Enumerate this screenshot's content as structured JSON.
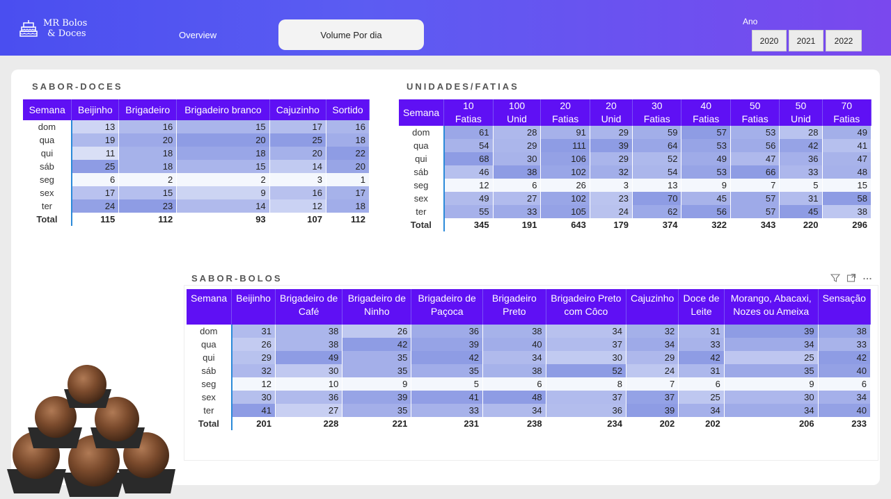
{
  "header": {
    "logo_line1": "MR Bolos",
    "logo_line2": "& Doces",
    "nav_overview": "Overview",
    "nav_volume": "Volume Por dia",
    "ano_label": "Ano",
    "years": [
      "2020",
      "2021",
      "2022"
    ]
  },
  "doces": {
    "title": "SABOR-DOCES",
    "columns": [
      "Semana",
      "Beijinho",
      "Brigadeiro",
      "Brigadeiro branco",
      "Cajuzinho",
      "Sortido"
    ],
    "rows": [
      [
        "dom",
        "13",
        "16",
        "15",
        "17",
        "16"
      ],
      [
        "qua",
        "19",
        "20",
        "20",
        "25",
        "18"
      ],
      [
        "qui",
        "11",
        "18",
        "18",
        "20",
        "22"
      ],
      [
        "sáb",
        "25",
        "18",
        "15",
        "14",
        "20"
      ],
      [
        "seg",
        "6",
        "2",
        "2",
        "3",
        "1"
      ],
      [
        "sex",
        "17",
        "15",
        "9",
        "16",
        "17"
      ],
      [
        "ter",
        "24",
        "23",
        "14",
        "12",
        "18"
      ]
    ],
    "total": [
      "Total",
      "115",
      "112",
      "93",
      "107",
      "112"
    ]
  },
  "unidades": {
    "title": "UNIDADES/FATIAS",
    "columns": [
      "Semana",
      "10 Fatias",
      "100 Unid",
      "20 Fatias",
      "20 Unid",
      "30 Fatias",
      "40 Fatias",
      "50 Fatias",
      "50 Unid",
      "70 Fatias"
    ],
    "rows": [
      [
        "dom",
        "61",
        "28",
        "91",
        "29",
        "59",
        "57",
        "53",
        "28",
        "49"
      ],
      [
        "qua",
        "54",
        "29",
        "111",
        "39",
        "64",
        "53",
        "56",
        "42",
        "41"
      ],
      [
        "qui",
        "68",
        "30",
        "106",
        "29",
        "52",
        "49",
        "47",
        "36",
        "47"
      ],
      [
        "sáb",
        "46",
        "38",
        "102",
        "32",
        "54",
        "53",
        "66",
        "33",
        "48"
      ],
      [
        "seg",
        "12",
        "6",
        "26",
        "3",
        "13",
        "9",
        "7",
        "5",
        "15"
      ],
      [
        "sex",
        "49",
        "27",
        "102",
        "23",
        "70",
        "45",
        "57",
        "31",
        "58"
      ],
      [
        "ter",
        "55",
        "33",
        "105",
        "24",
        "62",
        "56",
        "57",
        "45",
        "38"
      ]
    ],
    "total": [
      "Total",
      "345",
      "191",
      "643",
      "179",
      "374",
      "322",
      "343",
      "220",
      "296"
    ]
  },
  "bolos": {
    "title": "SABOR-BOLOS",
    "columns": [
      "Semana",
      "Beijinho",
      "Brigadeiro de Café",
      "Brigadeiro de Ninho",
      "Brigadeiro de Paçoca",
      "Brigadeiro Preto",
      "Brigadeiro Preto com Côco",
      "Cajuzinho",
      "Doce de Leite",
      "Morango, Abacaxi, Nozes ou Ameixa",
      "Sensação"
    ],
    "rows": [
      [
        "dom",
        "31",
        "38",
        "26",
        "36",
        "38",
        "34",
        "32",
        "31",
        "39",
        "38"
      ],
      [
        "qua",
        "26",
        "38",
        "42",
        "39",
        "40",
        "37",
        "34",
        "33",
        "34",
        "33"
      ],
      [
        "qui",
        "29",
        "49",
        "35",
        "42",
        "34",
        "30",
        "29",
        "42",
        "25",
        "42"
      ],
      [
        "sáb",
        "32",
        "30",
        "35",
        "35",
        "38",
        "52",
        "24",
        "31",
        "35",
        "40"
      ],
      [
        "seg",
        "12",
        "10",
        "9",
        "5",
        "6",
        "8",
        "7",
        "6",
        "9",
        "6"
      ],
      [
        "sex",
        "30",
        "36",
        "39",
        "41",
        "48",
        "37",
        "37",
        "25",
        "30",
        "34"
      ],
      [
        "ter",
        "41",
        "27",
        "35",
        "33",
        "34",
        "36",
        "39",
        "34",
        "34",
        "40"
      ]
    ],
    "total": [
      "Total",
      "201",
      "228",
      "221",
      "231",
      "238",
      "234",
      "202",
      "202",
      "206",
      "233"
    ]
  },
  "colors": {
    "header_start": "#4a4ef0",
    "header_end": "#7a48ee",
    "table_header": "#5f10f4",
    "heat_low": "#f4f7fd",
    "heat_high": "#8e9ce4"
  },
  "icons": [
    "cake-logo-icon",
    "filter-icon",
    "focus-mode-icon",
    "more-options-icon"
  ]
}
